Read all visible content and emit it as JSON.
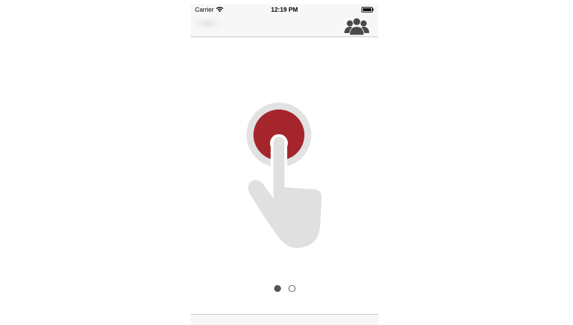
{
  "status_bar": {
    "carrier": "Carrier",
    "time": "12:19 PM",
    "icons": [
      "wifi-icon",
      "battery-icon"
    ]
  },
  "nav_bar": {
    "right_icon": "users-group-icon"
  },
  "hero": {
    "icons": [
      "red-record-button-icon",
      "pointing-hand-icon"
    ],
    "colors": {
      "button_red": "#a4262c",
      "ring_gray": "#e2e2e2",
      "hand_gray": "#e0e0e0"
    }
  },
  "page_control": {
    "page_count": 2,
    "current_page": 1
  },
  "colors": {
    "bar_background": "#f7f7f7",
    "separator": "#c8c8c8",
    "dot_active": "#555555",
    "icon_dark": "#4a4a4a"
  }
}
